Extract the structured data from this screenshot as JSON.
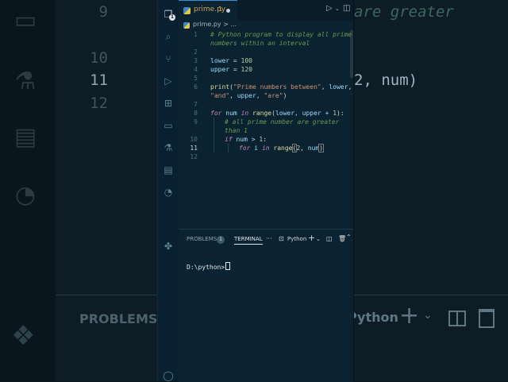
{
  "background": {
    "line_numbers": [
      "9",
      "10",
      "11",
      "12"
    ],
    "current_line": "11",
    "comment_fragment": "are greater",
    "code_fragment": "2, num)",
    "panel_label": "PROBLEMS",
    "terminal_profile": "Python"
  },
  "editor": {
    "tab": {
      "filename": "prime.py",
      "problem_count": "1",
      "modified": true
    },
    "breadcrumb": "prime.py > ...",
    "line_numbers": [
      "1",
      "2",
      "3",
      "4",
      "5",
      "6",
      "7",
      "8",
      "9",
      "10",
      "11",
      "12"
    ],
    "current_line": "11",
    "code": {
      "l1": "# Python program to display all prime",
      "l1b": "numbers within an interval",
      "l3_var": "lower",
      "l3_val": "100",
      "l4_var": "upper",
      "l4_val": "120",
      "l6_fn": "print",
      "l6_str1": "\"Prime numbers between\"",
      "l6_var1": "lower",
      "l6_str2": "\"and\"",
      "l6_var2": "upper",
      "l6_str3": "\"are\"",
      "l8_kw1": "for",
      "l8_var": "num",
      "l8_kw2": "in",
      "l8_fn": "range",
      "l8_args": "lower, upper + ",
      "l8_num": "1",
      "l9": "# all prime number are greater",
      "l9b": "than 1",
      "l10_kw": "if",
      "l10_expr": "num > ",
      "l10_num": "1",
      "l11_kw1": "for",
      "l11_var": "i",
      "l11_kw2": "in",
      "l11_fn": "range",
      "l11_num": "2",
      "l11_var2": "num"
    }
  },
  "panel": {
    "problems_label": "PROBLEMS",
    "problems_count": "1",
    "terminal_label": "TERMINAL",
    "more": "···",
    "profile": "Python",
    "prompt": "D:\\python>"
  },
  "colors": {
    "accent": "#3a8fd8",
    "background": "#0b2230"
  },
  "icons": [
    "explorer-icon",
    "search-icon",
    "source-control-icon",
    "run-debug-icon",
    "extensions-icon",
    "remote-explorer-icon",
    "testing-icon",
    "docker-icon",
    "git-graph-icon",
    "python-icon",
    "account-icon",
    "run-icon",
    "split-editor-icon",
    "more-icon",
    "add-terminal-icon",
    "trash-icon",
    "maximize-icon"
  ]
}
